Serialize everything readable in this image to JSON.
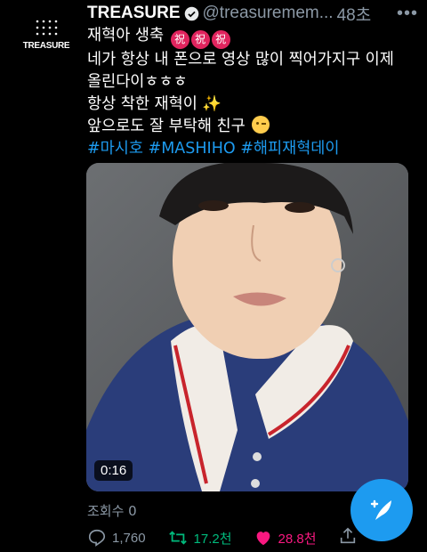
{
  "account": {
    "logo_text": "TREASURE",
    "name": "TREASURE",
    "handle": "@treasuremem...",
    "time": "48초"
  },
  "tweet": {
    "line1_text": "재혁아 생축",
    "line1_emoji": "祝",
    "line2": "네가 항상 내 폰으로 영상 많이 찍어가지구 이제",
    "line3": "올린다이ㅎㅎㅎ",
    "line4_text": "항상 착한 재혁이",
    "line4_emoji": "✨",
    "line5_text": "앞으로도 잘 부탁해 친구",
    "hashtags": [
      "#마시호",
      "#MASHIHO",
      "#해피재혁데이"
    ]
  },
  "video": {
    "duration": "0:16"
  },
  "stats": {
    "views": "조회수 0",
    "replies": "1,760",
    "retweets": "17.2천",
    "likes": "28.8천"
  },
  "colors": {
    "accent": "#1d9bf0",
    "retweet": "#00ba7c",
    "like": "#f91880",
    "muted": "#8b98a5"
  },
  "icons": {
    "verified": "verified-badge-icon",
    "more": "more-icon",
    "reply": "reply-icon",
    "retweet": "retweet-icon",
    "like": "heart-icon",
    "share": "share-icon",
    "compose": "compose-tweet-icon"
  }
}
